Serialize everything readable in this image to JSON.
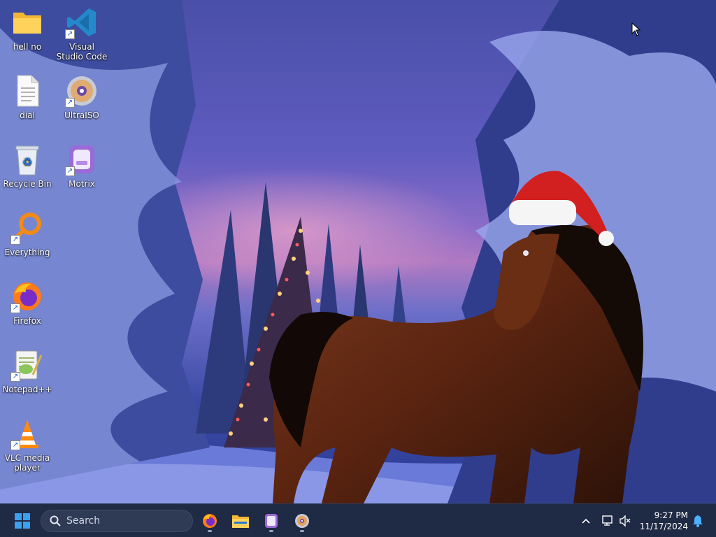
{
  "desktop": {
    "icons": [
      {
        "label": "hell no",
        "icon": "folder-icon"
      },
      {
        "label": "Visual Studio Code",
        "icon": "vscode-icon"
      },
      {
        "label": "dial",
        "icon": "text-file-icon"
      },
      {
        "label": "UltraISO",
        "icon": "disc-icon"
      },
      {
        "label": "Recycle Bin",
        "icon": "recycle-bin-icon"
      },
      {
        "label": "Motrix",
        "icon": "motrix-icon"
      },
      {
        "label": "Everything",
        "icon": "everything-icon"
      },
      {
        "label": "Firefox",
        "icon": "firefox-icon"
      },
      {
        "label": "Notepad++",
        "icon": "notepadpp-icon"
      },
      {
        "label": "VLC media player",
        "icon": "vlc-icon"
      }
    ]
  },
  "taskbar": {
    "search_placeholder": "Search",
    "pinned": [
      "firefox-icon",
      "file-explorer-icon",
      "motrix-icon",
      "ultraiso-icon"
    ],
    "clock": {
      "time": "9:27 PM",
      "date": "11/17/2024"
    }
  },
  "colors": {
    "taskbar_bg": "#1f2a44",
    "start_blue": "#3aa0f0",
    "bell_blue": "#4ab0ff"
  }
}
